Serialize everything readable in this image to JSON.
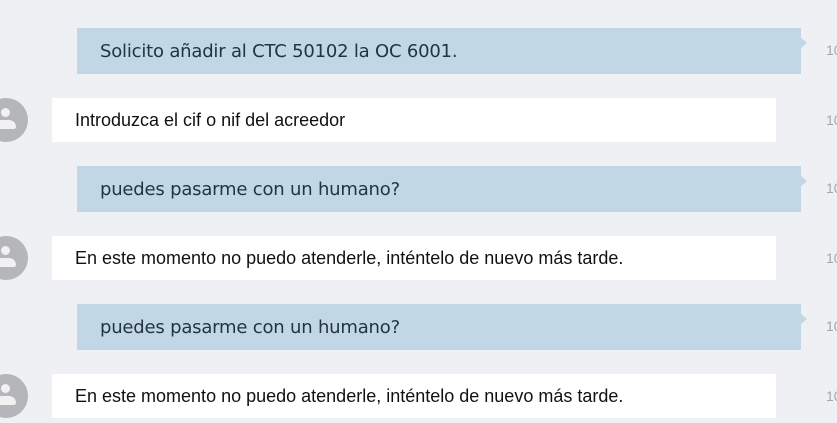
{
  "messages": [
    {
      "role": "user",
      "text": "Solicito añadir al CTC 50102 la OC 6001.",
      "time": "10"
    },
    {
      "role": "bot",
      "text": "Introduzca el cif o nif del acreedor",
      "time": "10"
    },
    {
      "role": "user",
      "text": "puedes pasarme con un humano?",
      "time": "10"
    },
    {
      "role": "bot",
      "text": "En este momento no puedo atenderle, inténtelo de nuevo más tarde.",
      "time": "10"
    },
    {
      "role": "user",
      "text": "puedes pasarme con un humano?",
      "time": "10"
    },
    {
      "role": "bot",
      "text": "En este momento no puedo atenderle, inténtelo de nuevo más tarde.",
      "time": "10"
    }
  ],
  "icons": {
    "bot_avatar": "user-avatar-icon"
  },
  "colors": {
    "background": "#eff0f4",
    "user_bubble": "#c1d7e5",
    "bot_bubble": "#ffffff",
    "avatar": "#b5b6b9",
    "timestamp": "#a3a6ab"
  }
}
